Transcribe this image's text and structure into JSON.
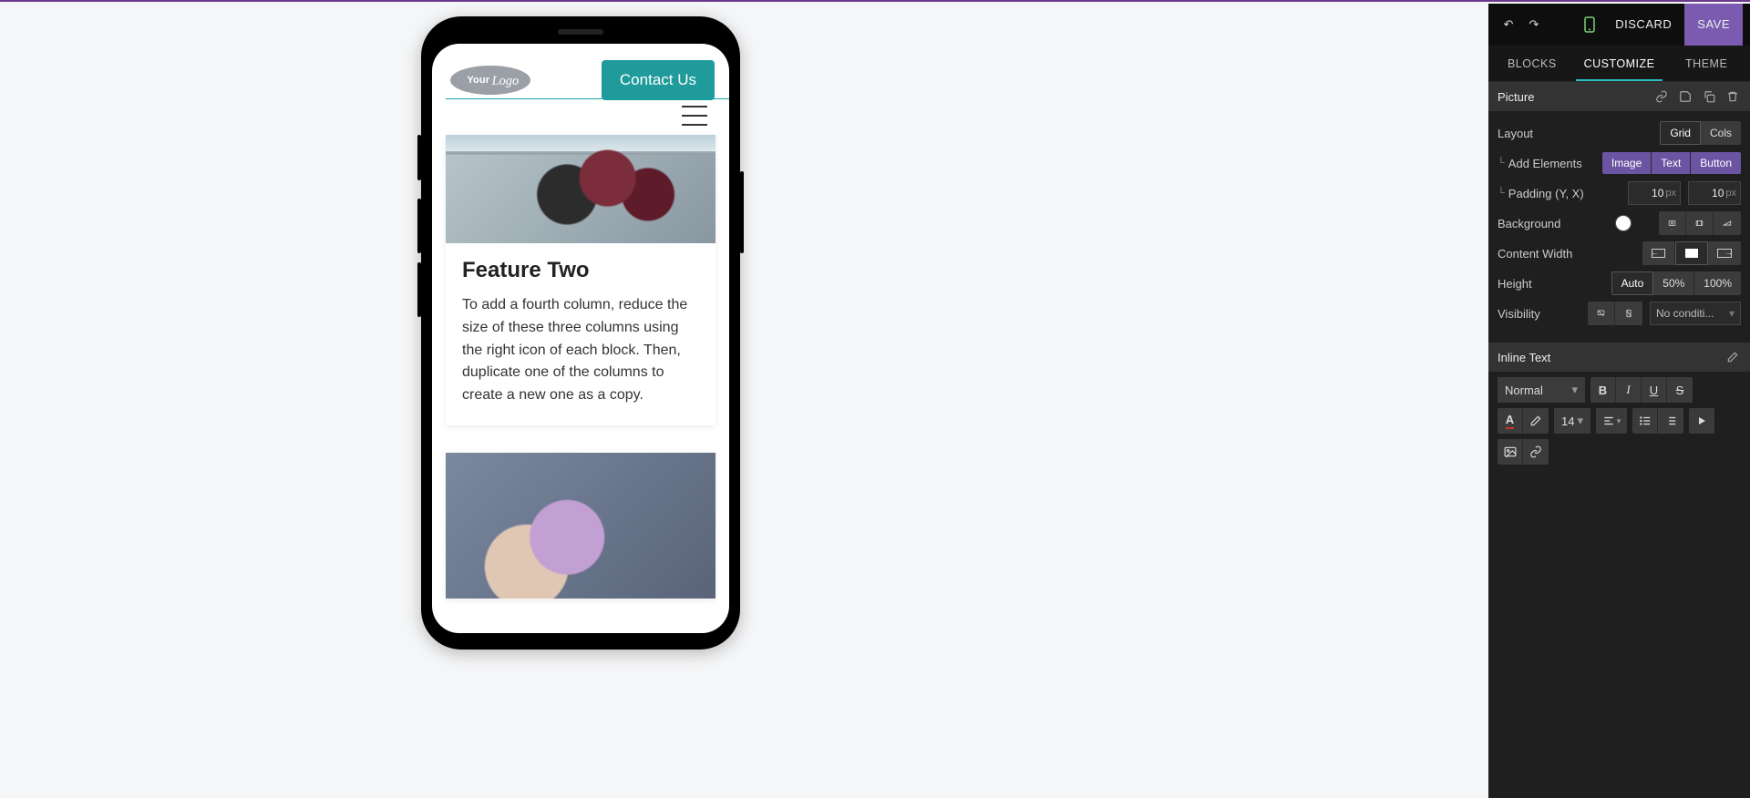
{
  "topbar": {
    "discard": "DISCARD",
    "save": "SAVE"
  },
  "tabs": {
    "blocks": "BLOCKS",
    "customize": "CUSTOMIZE",
    "theme": "THEME",
    "active": "customize"
  },
  "picture": {
    "title": "Picture",
    "layout_label": "Layout",
    "layout_grid": "Grid",
    "layout_cols": "Cols",
    "addel_label": "Add Elements",
    "addel_image": "Image",
    "addel_text": "Text",
    "addel_button": "Button",
    "padding_label": "Padding (Y, X)",
    "padding_y": "10",
    "padding_x": "10",
    "padding_unit": "px",
    "background_label": "Background",
    "background_color": "#ffffff",
    "contentw_label": "Content Width",
    "height_label": "Height",
    "height_auto": "Auto",
    "height_50": "50%",
    "height_100": "100%",
    "visibility_label": "Visibility",
    "visibility_value": "No conditi..."
  },
  "inline": {
    "title": "Inline Text",
    "style_value": "Normal",
    "size_value": "14"
  },
  "preview": {
    "contact_btn": "Contact Us",
    "card1": {
      "title": "Feature Two",
      "body": "To add a fourth column, reduce the size of these three columns using the right icon of each block. Then, duplicate one of the columns to create a new one as a copy."
    }
  }
}
